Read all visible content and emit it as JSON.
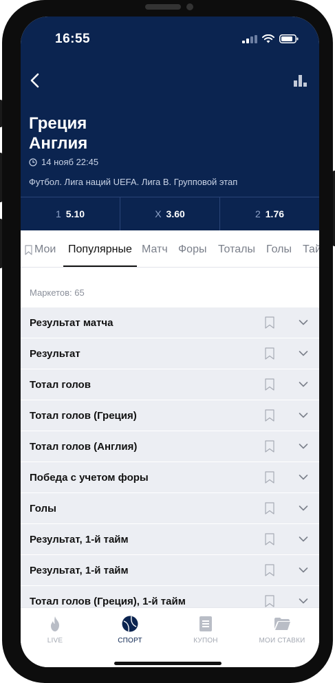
{
  "status_bar": {
    "time": "16:55"
  },
  "match": {
    "team_home": "Греция",
    "team_away": "Англия",
    "datetime": "14 нояб 22:45",
    "league": "Футбол. Лига наций UEFA. Лига B. Групповой этап"
  },
  "odds": [
    {
      "label": "1",
      "value": "5.10"
    },
    {
      "label": "X",
      "value": "3.60"
    },
    {
      "label": "2",
      "value": "1.76"
    }
  ],
  "tabs": [
    {
      "label": "Мои"
    },
    {
      "label": "Популярные"
    },
    {
      "label": "Матч"
    },
    {
      "label": "Форы"
    },
    {
      "label": "Тоталы"
    },
    {
      "label": "Голы"
    },
    {
      "label": "Тай"
    }
  ],
  "markets_count": "Маркетов: 65",
  "markets": [
    {
      "name": "Результат матча"
    },
    {
      "name": "Результат"
    },
    {
      "name": "Тотал голов"
    },
    {
      "name": "Тотал голов (Греция)"
    },
    {
      "name": "Тотал голов (Англия)"
    },
    {
      "name": "Победа с учетом форы"
    },
    {
      "name": "Голы"
    },
    {
      "name": "Результат, 1-й тайм"
    },
    {
      "name": "Результат, 1-й тайм"
    },
    {
      "name": "Тотал голов (Греция), 1-й тайм"
    }
  ],
  "bottom_nav": [
    {
      "label": "LIVE",
      "icon": "flame-icon"
    },
    {
      "label": "СПОРТ",
      "icon": "ball-icon"
    },
    {
      "label": "КУПОН",
      "icon": "coupon-icon"
    },
    {
      "label": "МОИ СТАВКИ",
      "icon": "folder-icon"
    }
  ],
  "colors": {
    "header_bg": "#0b2450",
    "market_row_bg": "#eceef3",
    "active_text": "#111111",
    "inactive_text": "#7a7f8a"
  }
}
